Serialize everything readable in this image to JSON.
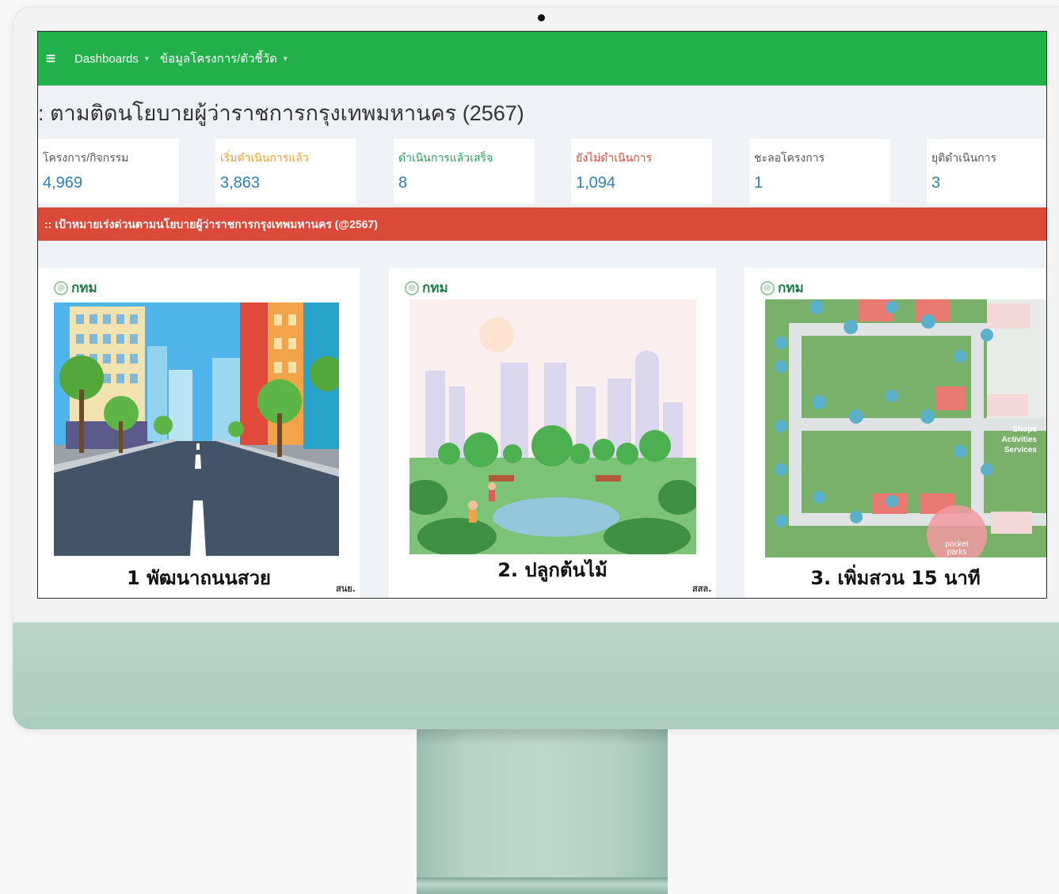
{
  "navbar": {
    "menu_icon": "hamburger-icon",
    "items": [
      {
        "label": "Dashboards"
      },
      {
        "label": "ข้อมูลโครงการ/ตัวชี้วัด"
      }
    ]
  },
  "page_title": ": ตามติดนโยบายผู้ว่าราชการกรุงเทพมหานคร (2567)",
  "stats": [
    {
      "label": "โครงการ/กิจกรรม",
      "value": "4,969",
      "label_color": "#555555"
    },
    {
      "label": "เริ่มดำเนินการแล้ว",
      "value": "3,863",
      "label_color": "#f0a030"
    },
    {
      "label": "ดำเนินการแล้วเสร็จ",
      "value": "8",
      "label_color": "#22a35a"
    },
    {
      "label": "ยังไม่ดำเนินการ",
      "value": "1,094",
      "label_color": "#e04a3a"
    },
    {
      "label": "ชะลอโครงการ",
      "value": "1",
      "label_color": "#555555"
    },
    {
      "label": "ยุติดำเนินการ",
      "value": "3",
      "label_color": "#555555"
    }
  ],
  "banner": ":: เป้าหมายเร่งด่วนตามนโยบายผู้ว่าราชการกรุงเทพมหานคร (@2567)",
  "cards": [
    {
      "logo": "กทม",
      "caption": "1 พัฒนาถนนสวย",
      "credit": "สนย.",
      "image": "city-road-illustration"
    },
    {
      "logo": "กทม",
      "caption": "2. ปลูกต้นไม้",
      "credit": "สสล.",
      "image": "park-trees-illustration"
    },
    {
      "logo": "กทม",
      "caption": "3. เพิ่มสวน 15 นาที",
      "credit": "",
      "image": "pocket-park-map-illustration",
      "map_labels": {
        "side": [
          "Shops",
          "Activities",
          "Services"
        ],
        "badge": [
          "pocket",
          "parks"
        ]
      }
    }
  ],
  "colors": {
    "navbar": "#22b04b",
    "banner": "#db4a39",
    "value": "#2f7fb8",
    "frame": "#b8d6c9"
  }
}
